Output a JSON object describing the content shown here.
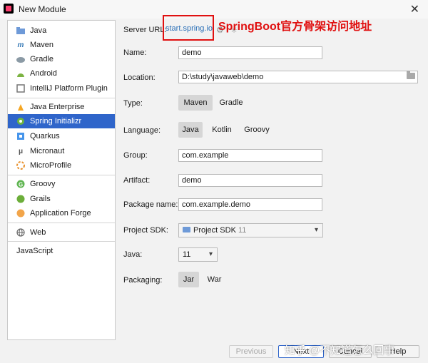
{
  "window": {
    "title": "New Module"
  },
  "sidebar": {
    "items": [
      {
        "label": "Java",
        "icon": "java-folder-icon"
      },
      {
        "label": "Maven",
        "icon": "maven-icon"
      },
      {
        "label": "Gradle",
        "icon": "gradle-icon"
      },
      {
        "label": "Android",
        "icon": "android-icon"
      },
      {
        "label": "IntelliJ Platform Plugin",
        "icon": "plugin-icon"
      },
      {
        "label": "Java Enterprise",
        "icon": "java-enterprise-icon"
      },
      {
        "label": "Spring Initializr",
        "icon": "spring-icon"
      },
      {
        "label": "Quarkus",
        "icon": "quarkus-icon"
      },
      {
        "label": "Micronaut",
        "icon": "micronaut-icon"
      },
      {
        "label": "MicroProfile",
        "icon": "microprofile-icon"
      },
      {
        "label": "Groovy",
        "icon": "groovy-icon"
      },
      {
        "label": "Grails",
        "icon": "grails-icon"
      },
      {
        "label": "Application Forge",
        "icon": "forge-icon"
      },
      {
        "label": "Web",
        "icon": "web-globe-icon"
      },
      {
        "label": "JavaScript",
        "icon": ""
      }
    ],
    "selected": "Spring Initializr"
  },
  "form": {
    "server_url_label": "Server URL:",
    "server_url_value": "start.spring.io",
    "annotation": "SpringBoot官方骨架访问地址",
    "name_label": "Name:",
    "name_value": "demo",
    "location_label": "Location:",
    "location_value": "D:\\study\\javaweb\\demo",
    "type_label": "Type:",
    "type_options": [
      "Maven",
      "Gradle"
    ],
    "language_label": "Language:",
    "language_options": [
      "Java",
      "Kotlin",
      "Groovy"
    ],
    "group_label": "Group:",
    "group_value": "com.example",
    "artifact_label": "Artifact:",
    "artifact_value": "demo",
    "package_label": "Package name:",
    "package_value": "com.example.demo",
    "sdk_label": "Project SDK:",
    "sdk_value": "Project SDK",
    "sdk_version": "11",
    "java_label": "Java:",
    "java_value": "11",
    "packaging_label": "Packaging:",
    "packaging_options": [
      "Jar",
      "War"
    ]
  },
  "buttons": {
    "previous": "Previous",
    "next": "Next",
    "cancel": "Cancel",
    "help": "Help"
  },
  "watermark": "知乎 @不知道怎么回事",
  "colors": {
    "selection": "#2f65ca",
    "annotation": "#e01010",
    "link": "#2a6fb7"
  }
}
